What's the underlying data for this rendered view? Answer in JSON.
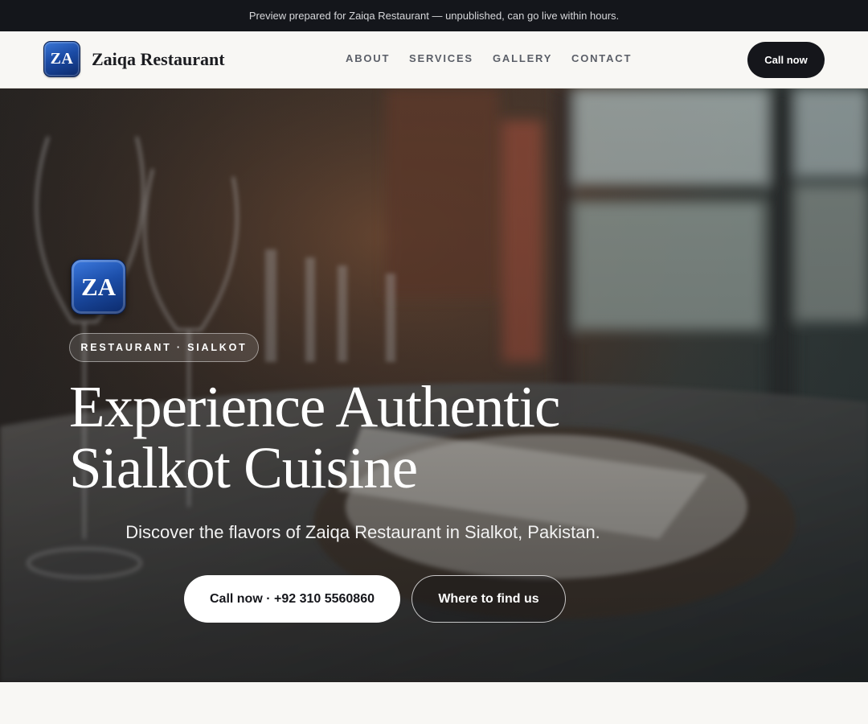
{
  "banner": {
    "text": "Preview prepared for Zaiqa Restaurant — unpublished, can go live within hours."
  },
  "header": {
    "logo_text": "ZA",
    "brand_name": "Zaiqa Restaurant",
    "nav": [
      {
        "label": "ABOUT"
      },
      {
        "label": "SERVICES"
      },
      {
        "label": "GALLERY"
      },
      {
        "label": "CONTACT"
      }
    ],
    "cta_label": "Call now"
  },
  "hero": {
    "logo_text": "ZA",
    "eyebrow": "RESTAURANT · SIALKOT",
    "title_line1": "Experience Authentic",
    "title_line2": "Sialkot Cuisine",
    "subtitle": "Discover the flavors of Zaiqa Restaurant in Sialkot, Pakistan.",
    "primary_button": "Call now · +92 310 5560860",
    "secondary_button": "Where to find us"
  },
  "colors": {
    "banner_bg": "#14161b",
    "header_bg": "#f8f7f4",
    "cta_bg": "#15161b",
    "logo_blue": "#1b4ba5"
  }
}
